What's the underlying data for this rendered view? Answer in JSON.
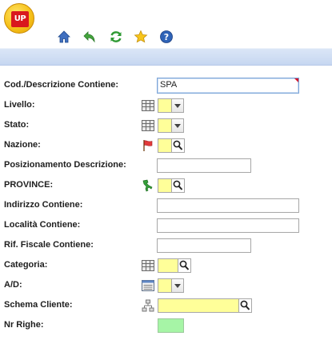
{
  "header": {
    "logo_text": "UP",
    "toolbar": {
      "home": "home-icon",
      "back": "back-arrow-icon",
      "refresh": "refresh-icon",
      "favorite": "star-icon",
      "help": "help-icon"
    }
  },
  "form": {
    "cod_desc": {
      "label": "Cod./Descrizione Contiene:",
      "value": "SPA"
    },
    "livello": {
      "label": "Livello:"
    },
    "stato": {
      "label": "Stato:"
    },
    "nazione": {
      "label": "Nazione:"
    },
    "posizionamento": {
      "label": "Posizionamento Descrizione:"
    },
    "province": {
      "label": "PROVINCE:"
    },
    "indirizzo": {
      "label": "Indirizzo Contiene:"
    },
    "localita": {
      "label": "Località Contiene:"
    },
    "rif_fiscale": {
      "label": "Rif. Fiscale Contiene:"
    },
    "categoria": {
      "label": "Categoria:"
    },
    "ad": {
      "label": "A/D:"
    },
    "schema_cliente": {
      "label": "Schema Cliente:"
    },
    "nr_righe": {
      "label": "Nr Righe:"
    }
  },
  "colors": {
    "band": "#c6d7f1",
    "required_field": "#ffff99",
    "numeric_field": "#a6f5a6",
    "focus_border": "#7ea6d8"
  }
}
